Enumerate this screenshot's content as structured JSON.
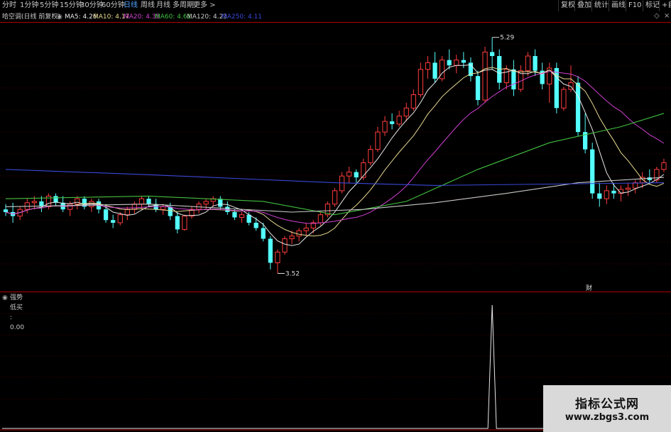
{
  "toolbar": {
    "timeframes": [
      "分时",
      "1分钟",
      "5分钟",
      "15分钟",
      "30分钟",
      "60分钟",
      "日线",
      "周线",
      "月线",
      "多周期",
      "更多 >"
    ],
    "active": "日线",
    "right_buttons": [
      "复权",
      "叠加",
      "统计",
      "画线",
      "F10",
      "标记",
      "+自"
    ]
  },
  "main_info": {
    "title": "哈空调(日线 前复权)",
    "ma": [
      {
        "label": "MA5: 4.26",
        "color": "#e8e8e8"
      },
      {
        "label": "MA10: 4.17",
        "color": "#e8d890"
      },
      {
        "label": "MA20: 4.35",
        "color": "#d040d0"
      },
      {
        "label": "MA60: 4.61",
        "color": "#40c040"
      },
      {
        "label": "MA120: 4.23",
        "color": "#c8c8c8"
      },
      {
        "label": "MA250: 4.11",
        "color": "#3a48d8"
      }
    ]
  },
  "indicator_info": {
    "label": "强势低买 : 0.00"
  },
  "annotations": {
    "high": "5.29",
    "low": "3.52",
    "event": "财"
  },
  "watermark": {
    "line1": "指标公式网",
    "line2": "www.zbgs3.com"
  },
  "colors": {
    "up": "#ff3c3c",
    "down": "#54ffff",
    "grid": "#8a0000",
    "border": "#b00000"
  },
  "chart_data": {
    "type": "candlestick",
    "y_range": [
      3.4,
      5.4
    ],
    "candles": [
      [
        4.0,
        4.04,
        3.95,
        3.98
      ],
      [
        3.98,
        4.05,
        3.9,
        3.95
      ],
      [
        3.95,
        4.02,
        3.92,
        4.0
      ],
      [
        4.0,
        4.08,
        3.97,
        4.05
      ],
      [
        4.05,
        4.1,
        4.0,
        4.06
      ],
      [
        4.06,
        4.1,
        3.98,
        4.02
      ],
      [
        4.02,
        4.12,
        4.0,
        4.1
      ],
      [
        4.1,
        4.12,
        4.03,
        4.05
      ],
      [
        4.05,
        4.1,
        3.98,
        4.0
      ],
      [
        4.0,
        4.06,
        3.95,
        4.04
      ],
      [
        4.04,
        4.1,
        4.0,
        4.08
      ],
      [
        4.08,
        4.1,
        4.0,
        4.02
      ],
      [
        4.02,
        4.08,
        3.98,
        4.06
      ],
      [
        4.06,
        4.08,
        3.97,
        4.0
      ],
      [
        4.0,
        4.04,
        3.9,
        3.92
      ],
      [
        3.92,
        3.96,
        3.86,
        3.9
      ],
      [
        3.9,
        3.98,
        3.88,
        3.96
      ],
      [
        3.96,
        4.02,
        3.92,
        4.0
      ],
      [
        4.0,
        4.06,
        3.97,
        4.04
      ],
      [
        4.04,
        4.1,
        4.0,
        4.08
      ],
      [
        4.08,
        4.1,
        4.02,
        4.04
      ],
      [
        4.04,
        4.08,
        3.98,
        4.0
      ],
      [
        4.0,
        4.04,
        3.96,
        4.02
      ],
      [
        4.02,
        4.05,
        3.92,
        3.95
      ],
      [
        3.95,
        3.98,
        3.82,
        3.85
      ],
      [
        3.85,
        3.96,
        3.84,
        3.95
      ],
      [
        3.95,
        4.02,
        3.93,
        4.0
      ],
      [
        4.0,
        4.06,
        3.97,
        4.04
      ],
      [
        4.04,
        4.08,
        4.0,
        4.06
      ],
      [
        4.06,
        4.1,
        4.02,
        4.08
      ],
      [
        4.08,
        4.1,
        4.0,
        4.02
      ],
      [
        4.02,
        4.06,
        3.96,
        3.98
      ],
      [
        3.98,
        4.0,
        3.92,
        3.94
      ],
      [
        3.94,
        3.98,
        3.9,
        3.96
      ],
      [
        3.96,
        3.98,
        3.88,
        3.9
      ],
      [
        3.9,
        3.94,
        3.84,
        3.86
      ],
      [
        3.86,
        3.9,
        3.76,
        3.78
      ],
      [
        3.78,
        3.8,
        3.55,
        3.6
      ],
      [
        3.6,
        3.7,
        3.52,
        3.68
      ],
      [
        3.68,
        3.8,
        3.66,
        3.78
      ],
      [
        3.78,
        3.84,
        3.74,
        3.8
      ],
      [
        3.8,
        3.86,
        3.76,
        3.84
      ],
      [
        3.84,
        3.9,
        3.8,
        3.86
      ],
      [
        3.86,
        3.92,
        3.82,
        3.9
      ],
      [
        3.9,
        3.98,
        3.88,
        3.96
      ],
      [
        3.96,
        4.06,
        3.94,
        4.04
      ],
      [
        4.04,
        4.16,
        4.02,
        4.14
      ],
      [
        4.14,
        4.28,
        4.12,
        4.25
      ],
      [
        4.25,
        4.32,
        4.2,
        4.28
      ],
      [
        4.28,
        4.3,
        4.2,
        4.24
      ],
      [
        4.24,
        4.38,
        4.22,
        4.35
      ],
      [
        4.35,
        4.48,
        4.33,
        4.45
      ],
      [
        4.45,
        4.62,
        4.43,
        4.58
      ],
      [
        4.58,
        4.7,
        4.55,
        4.66
      ],
      [
        4.66,
        4.72,
        4.6,
        4.64
      ],
      [
        4.64,
        4.74,
        4.62,
        4.7
      ],
      [
        4.7,
        4.8,
        4.66,
        4.76
      ],
      [
        4.76,
        4.9,
        4.74,
        4.86
      ],
      [
        4.86,
        5.1,
        4.84,
        5.05
      ],
      [
        5.05,
        5.15,
        4.98,
        5.1
      ],
      [
        5.1,
        5.18,
        4.95,
        4.98
      ],
      [
        4.98,
        5.15,
        4.96,
        5.12
      ],
      [
        5.12,
        5.2,
        5.05,
        5.08
      ],
      [
        5.08,
        5.16,
        5.02,
        5.12
      ],
      [
        5.12,
        5.18,
        5.06,
        5.1
      ],
      [
        5.1,
        5.14,
        4.96,
        5.0
      ],
      [
        5.0,
        5.04,
        4.78,
        4.82
      ],
      [
        4.82,
        5.22,
        4.8,
        5.18
      ],
      [
        5.18,
        5.29,
        5.05,
        5.15
      ],
      [
        5.15,
        5.2,
        4.9,
        4.95
      ],
      [
        4.95,
        5.08,
        4.9,
        5.05
      ],
      [
        5.05,
        5.12,
        4.85,
        4.9
      ],
      [
        4.9,
        5.08,
        4.88,
        5.04
      ],
      [
        5.04,
        5.18,
        5.0,
        5.15
      ],
      [
        5.15,
        5.2,
        5.0,
        5.04
      ],
      [
        5.04,
        5.1,
        4.9,
        4.94
      ],
      [
        4.94,
        5.1,
        4.8,
        5.06
      ],
      [
        5.06,
        5.1,
        4.72,
        4.76
      ],
      [
        4.76,
        4.92,
        4.74,
        4.9
      ],
      [
        4.9,
        5.08,
        4.88,
        4.95
      ],
      [
        4.95,
        5.0,
        4.55,
        4.58
      ],
      [
        4.58,
        4.72,
        4.42,
        4.45
      ],
      [
        4.45,
        4.5,
        4.08,
        4.12
      ],
      [
        4.12,
        4.2,
        4.02,
        4.08
      ],
      [
        4.08,
        4.18,
        4.04,
        4.14
      ],
      [
        4.14,
        4.2,
        4.08,
        4.12
      ],
      [
        4.12,
        4.18,
        4.06,
        4.15
      ],
      [
        4.15,
        4.2,
        4.1,
        4.16
      ],
      [
        4.16,
        4.22,
        4.12,
        4.2
      ],
      [
        4.2,
        4.28,
        4.16,
        4.24
      ],
      [
        4.24,
        4.3,
        4.2,
        4.22
      ],
      [
        4.22,
        4.32,
        4.2,
        4.3
      ],
      [
        4.3,
        4.38,
        4.28,
        4.35
      ]
    ],
    "ma_periods": [
      5,
      10,
      20
    ],
    "long_ma": {
      "ma60": [
        [
          0,
          4.08
        ],
        [
          20,
          4.1
        ],
        [
          36,
          4.06
        ],
        [
          46,
          3.96
        ],
        [
          56,
          4.06
        ],
        [
          66,
          4.3
        ],
        [
          76,
          4.5
        ],
        [
          86,
          4.62
        ],
        [
          92,
          4.72
        ]
      ],
      "ma120": [
        [
          0,
          4.02
        ],
        [
          20,
          4.04
        ],
        [
          40,
          3.98
        ],
        [
          50,
          4.0
        ],
        [
          60,
          4.05
        ],
        [
          70,
          4.12
        ],
        [
          80,
          4.2
        ],
        [
          92,
          4.24
        ]
      ],
      "ma250": [
        [
          0,
          4.3
        ],
        [
          20,
          4.26
        ],
        [
          46,
          4.2
        ],
        [
          60,
          4.18
        ],
        [
          76,
          4.19
        ],
        [
          92,
          4.2
        ]
      ]
    },
    "indicator": {
      "name": "强势低买",
      "signal_index": 68,
      "value": 0.0
    }
  }
}
